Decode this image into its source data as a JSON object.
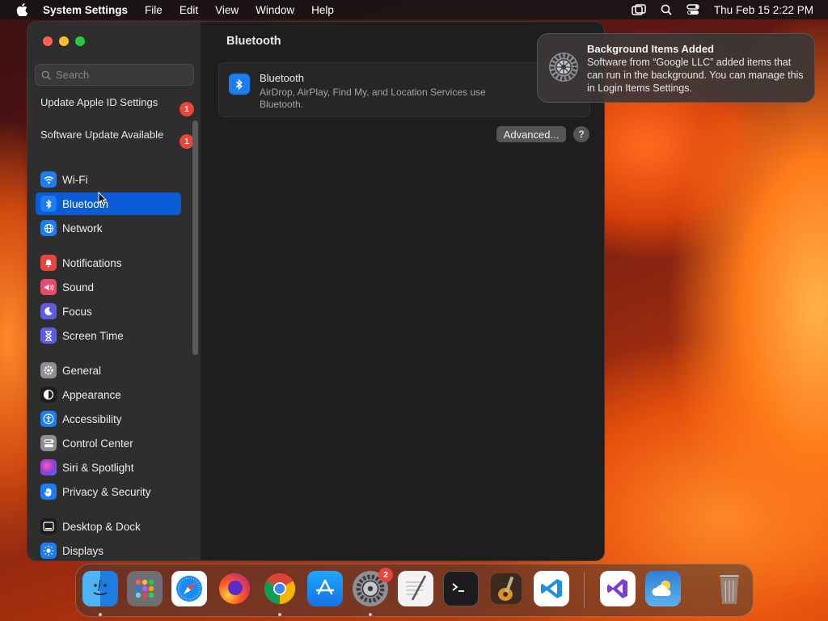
{
  "menubar": {
    "app_name": "System Settings",
    "menus": [
      "File",
      "Edit",
      "View",
      "Window",
      "Help"
    ],
    "clock": "Thu Feb 15  2:22 PM"
  },
  "window": {
    "title": "Bluetooth",
    "search_placeholder": "Search",
    "notices": [
      {
        "label": "Update Apple ID Settings",
        "badge": "1"
      },
      {
        "label": "Software Update Available",
        "badge": "1"
      }
    ],
    "sidebar_items": [
      {
        "label": "Wi-Fi",
        "icon": "wifi-icon",
        "color": "#1d7cf2"
      },
      {
        "label": "Bluetooth",
        "icon": "bluetooth-icon",
        "color": "#1d7cf2",
        "selected": true
      },
      {
        "label": "Network",
        "icon": "globe-icon",
        "color": "#1d7cf2"
      },
      {
        "label": "Notifications",
        "icon": "bell-icon",
        "color": "#e8453c"
      },
      {
        "label": "Sound",
        "icon": "speaker-icon",
        "color": "#e84a6c"
      },
      {
        "label": "Focus",
        "icon": "moon-icon",
        "color": "#5e5ce6"
      },
      {
        "label": "Screen Time",
        "icon": "hourglass-icon",
        "color": "#5e5ce6"
      },
      {
        "label": "General",
        "icon": "gear-icon",
        "color": "#8e8e93"
      },
      {
        "label": "Appearance",
        "icon": "appearance-icon",
        "color": "#1c1c1e"
      },
      {
        "label": "Accessibility",
        "icon": "accessibility-icon",
        "color": "#1d7cf2"
      },
      {
        "label": "Control Center",
        "icon": "control-center-icon",
        "color": "#8e8e93"
      },
      {
        "label": "Siri & Spotlight",
        "icon": "siri-icon",
        "color": "#9b3fd6"
      },
      {
        "label": "Privacy & Security",
        "icon": "hand-icon",
        "color": "#1d7cf2"
      },
      {
        "label": "Desktop & Dock",
        "icon": "dock-icon",
        "color": "#1c1c1e"
      },
      {
        "label": "Displays",
        "icon": "sun-icon",
        "color": "#1d7cf2"
      }
    ],
    "bluetooth_card": {
      "title": "Bluetooth",
      "description": "AirDrop, AirPlay, Find My, and Location Services use Bluetooth."
    },
    "advanced_label": "Advanced...",
    "help_label": "?"
  },
  "notification": {
    "title": "Background Items Added",
    "body": "Software from “Google LLC” added items that can run in the background. You can manage this in Login Items Settings."
  },
  "dock": {
    "apps": [
      "Finder",
      "Launchpad",
      "Safari",
      "Firefox",
      "Chrome",
      "App Store",
      "System Settings",
      "TextEdit",
      "Terminal",
      "GarageBand",
      "VS Code",
      "Visual Studio",
      "Weather",
      "Trash"
    ],
    "system_settings_badge": "2"
  }
}
